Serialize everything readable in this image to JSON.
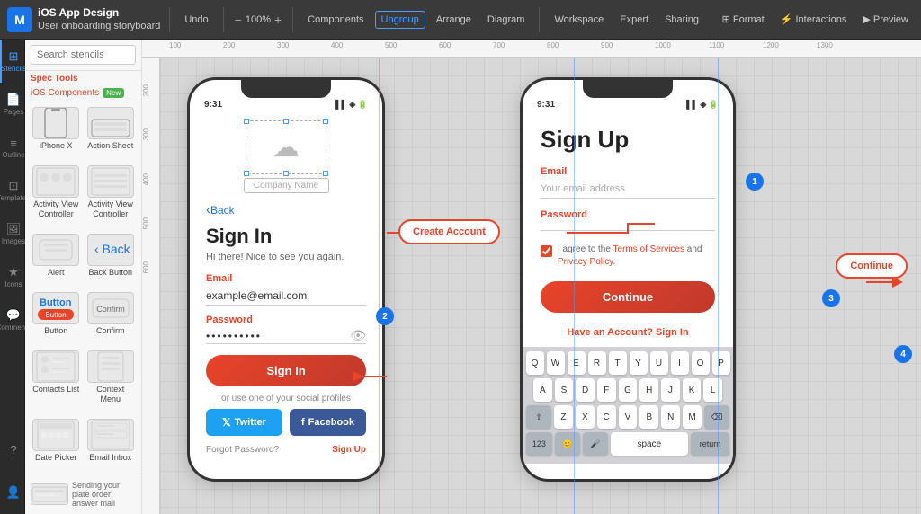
{
  "app": {
    "logo": "M",
    "title": "iOS App Design",
    "subtitle": "User onboarding storyboard",
    "undo_label": "Undo"
  },
  "toolbar": {
    "zoom": "100%",
    "zoom_minus": "−",
    "zoom_plus": "+",
    "components_label": "Components",
    "ungroup_label": "Ungroup",
    "arrange_label": "Arrange",
    "diagram_label": "Diagram",
    "workspace_label": "Workspace",
    "expert_label": "Expert",
    "sharing_label": "Sharing",
    "format_label": "Format",
    "interactions_label": "Interactions",
    "preview_label": "Preview"
  },
  "sidebar": {
    "search_placeholder": "Search stencils",
    "tab_stencils": "Stencils",
    "tab_spec_tools": "Spec Tools",
    "tab_ios": "iOS Components",
    "new_badge": "New",
    "nav_items": [
      {
        "id": "stencils",
        "icon": "⊞",
        "label": "Stencils"
      },
      {
        "id": "pages",
        "icon": "📄",
        "label": "Pages"
      },
      {
        "id": "outline",
        "icon": "≡",
        "label": "Outline"
      },
      {
        "id": "templates",
        "icon": "⊡",
        "label": "Templates"
      },
      {
        "id": "images",
        "icon": "🖼",
        "label": "Images"
      },
      {
        "id": "icons",
        "icon": "★",
        "label": "Icons"
      },
      {
        "id": "comments",
        "icon": "💬",
        "label": "Comments"
      }
    ],
    "stencils": [
      {
        "label": "iPhone X",
        "thumb_type": "phone"
      },
      {
        "label": "Action Sheet",
        "thumb_type": "sheet"
      },
      {
        "label": "Activity View Controller",
        "thumb_type": "activity"
      },
      {
        "label": "Activity View Controller",
        "thumb_type": "activity2"
      },
      {
        "label": "Alert",
        "thumb_type": "alert"
      },
      {
        "label": "Back Button",
        "thumb_type": "back"
      },
      {
        "label": "Button",
        "thumb_type": "button-blue"
      },
      {
        "label": "Confirm",
        "thumb_type": "confirm"
      },
      {
        "label": "Contacts List",
        "thumb_type": "contacts"
      },
      {
        "label": "Context Menu",
        "thumb_type": "context"
      },
      {
        "label": "Date Picker",
        "thumb_type": "datepicker"
      },
      {
        "label": "Email Inbox",
        "thumb_type": "email"
      }
    ]
  },
  "signin_screen": {
    "status_time": "9:31",
    "logo_text": "",
    "company_name": "Company Name",
    "title": "Sign In",
    "subtitle": "Hi there! Nice to see you again.",
    "email_label": "Email",
    "email_value": "example@email.com",
    "password_label": "Password",
    "password_value": "••••••••••",
    "signin_btn": "Sign In",
    "or_text": "or use one of your social profiles",
    "twitter_btn": "Twitter",
    "facebook_btn": "Facebook",
    "forgot_label": "Forgot Password?",
    "signup_link": "Sign Up",
    "back_label": "Back"
  },
  "signup_screen": {
    "status_time": "9:31",
    "title": "Sign Up",
    "email_label": "Email",
    "email_placeholder": "Your email address",
    "password_label": "Password",
    "terms_text": "I agree to the Terms of Services and Privacy Policy.",
    "continue_btn": "Continue",
    "have_account_text": "Have an Account?",
    "signin_link": "Sign In"
  },
  "keyboard": {
    "rows": [
      [
        "Q",
        "W",
        "E",
        "R",
        "T",
        "Y",
        "U",
        "I",
        "O",
        "P"
      ],
      [
        "A",
        "S",
        "D",
        "F",
        "G",
        "H",
        "J",
        "K",
        "L"
      ],
      [
        "⇧",
        "Z",
        "X",
        "C",
        "V",
        "B",
        "N",
        "M",
        "⌫"
      ],
      [
        "123",
        "😊",
        "🎤",
        "space",
        "return"
      ]
    ]
  },
  "connectors": {
    "create_account_btn": "Create Account",
    "continue_btn": "Continue"
  },
  "bubbles": [
    {
      "number": "1",
      "color": "#1a73e8"
    },
    {
      "number": "2",
      "color": "#1a73e8"
    },
    {
      "number": "3",
      "color": "#1a73e8"
    },
    {
      "number": "4",
      "color": "#1a73e8"
    }
  ],
  "right_panel": {
    "format_label": "Format",
    "interactions_label": "Interactions",
    "preview_label": "Preview"
  }
}
